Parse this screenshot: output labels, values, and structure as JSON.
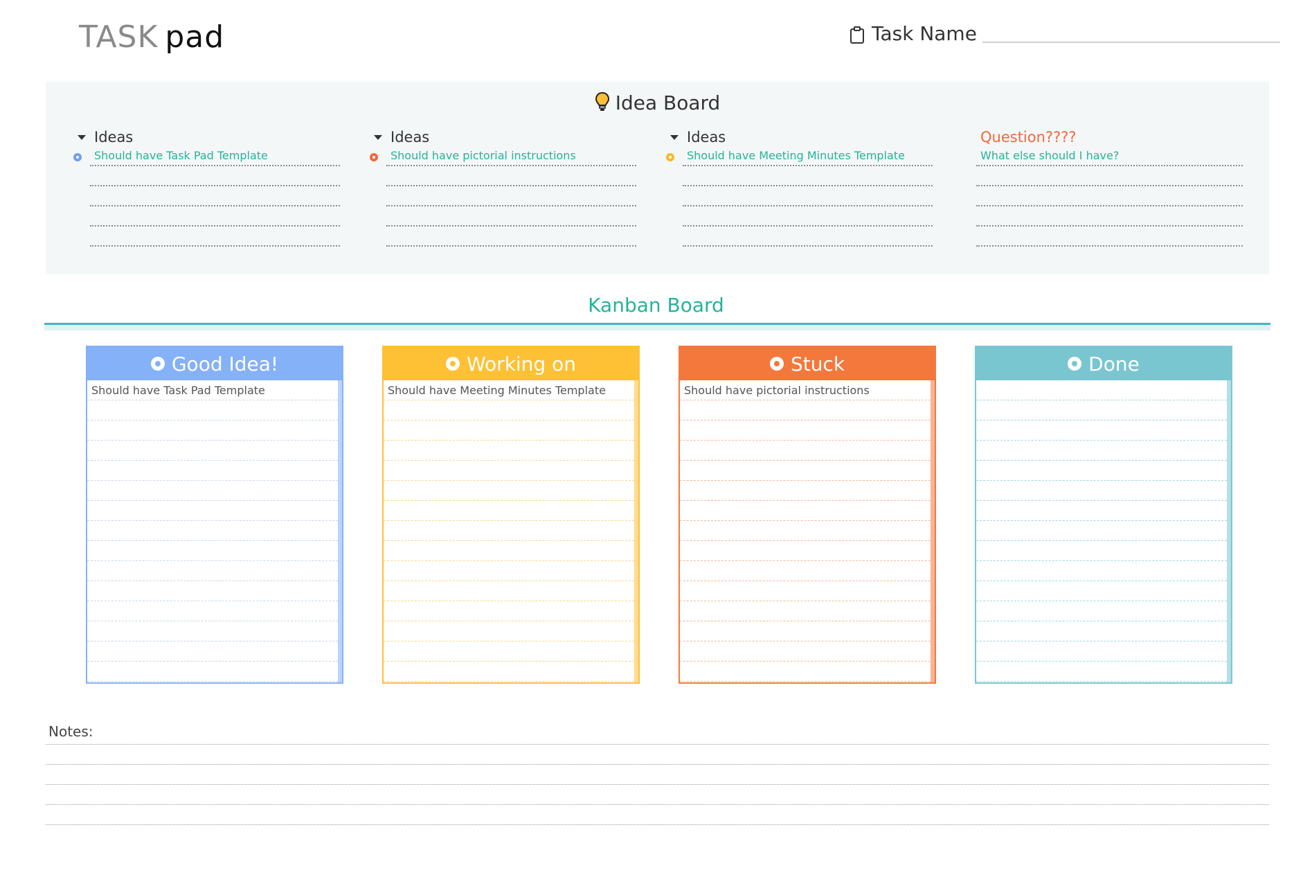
{
  "header": {
    "brand_task": "TASK",
    "brand_pad": "pad",
    "task_name_label": "Task Name",
    "task_name_icon": "clipboard-icon"
  },
  "idea_board": {
    "title": "Idea Board",
    "title_icon": "lightbulb-icon",
    "columns": [
      {
        "heading": "Ideas",
        "dot_color": "#6f9ff0",
        "items": [
          "Should have Task Pad Template",
          "",
          "",
          "",
          ""
        ]
      },
      {
        "heading": "Ideas",
        "dot_color": "#f2683a",
        "items": [
          "Should have pictorial instructions",
          "",
          "",
          "",
          ""
        ]
      },
      {
        "heading": "Ideas",
        "dot_color": "#fbb828",
        "items": [
          "Should have Meeting Minutes Template",
          "",
          "",
          "",
          ""
        ]
      },
      {
        "heading": "Question????",
        "items": [
          "What else should I have?",
          "",
          "",
          "",
          ""
        ]
      }
    ]
  },
  "kanban": {
    "title": "Kanban Board",
    "columns": [
      {
        "title": "Good Idea!",
        "color": "#84b1f7",
        "line_color": "#c9d6ea",
        "items": [
          "Should have Task Pad Template"
        ]
      },
      {
        "title": "Working on",
        "color": "#fec034",
        "line_color": "#fbd58b",
        "items": [
          "Should have Meeting Minutes Template"
        ]
      },
      {
        "title": "Stuck",
        "color": "#f4783b",
        "line_color": "#f5b79a",
        "items": [
          "Should have pictorial instructions"
        ]
      },
      {
        "title": "Done",
        "color": "#79c6d0",
        "line_color": "#9fd8dd",
        "items": []
      }
    ]
  },
  "notes": {
    "label": "Notes:"
  },
  "colors": {
    "accent_teal": "#25b39a",
    "question_orange": "#f2683a",
    "board_bg": "#f4f7f8"
  }
}
